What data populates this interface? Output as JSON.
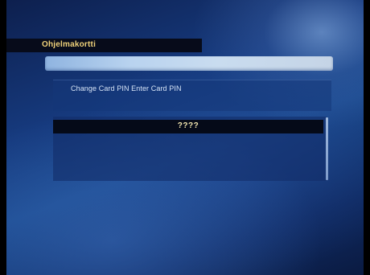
{
  "menu": {
    "title": "Ohjelmakortti"
  },
  "dialog": {
    "message": "Change Card PIN Enter Card PIN",
    "pin_value": "????"
  },
  "colors": {
    "title_text": "#f0d27a",
    "message_text": "#d6e4f6",
    "pin_text": "#f2e6b0",
    "accent_bar": "#b9d3ef",
    "background": "#163a7e"
  }
}
